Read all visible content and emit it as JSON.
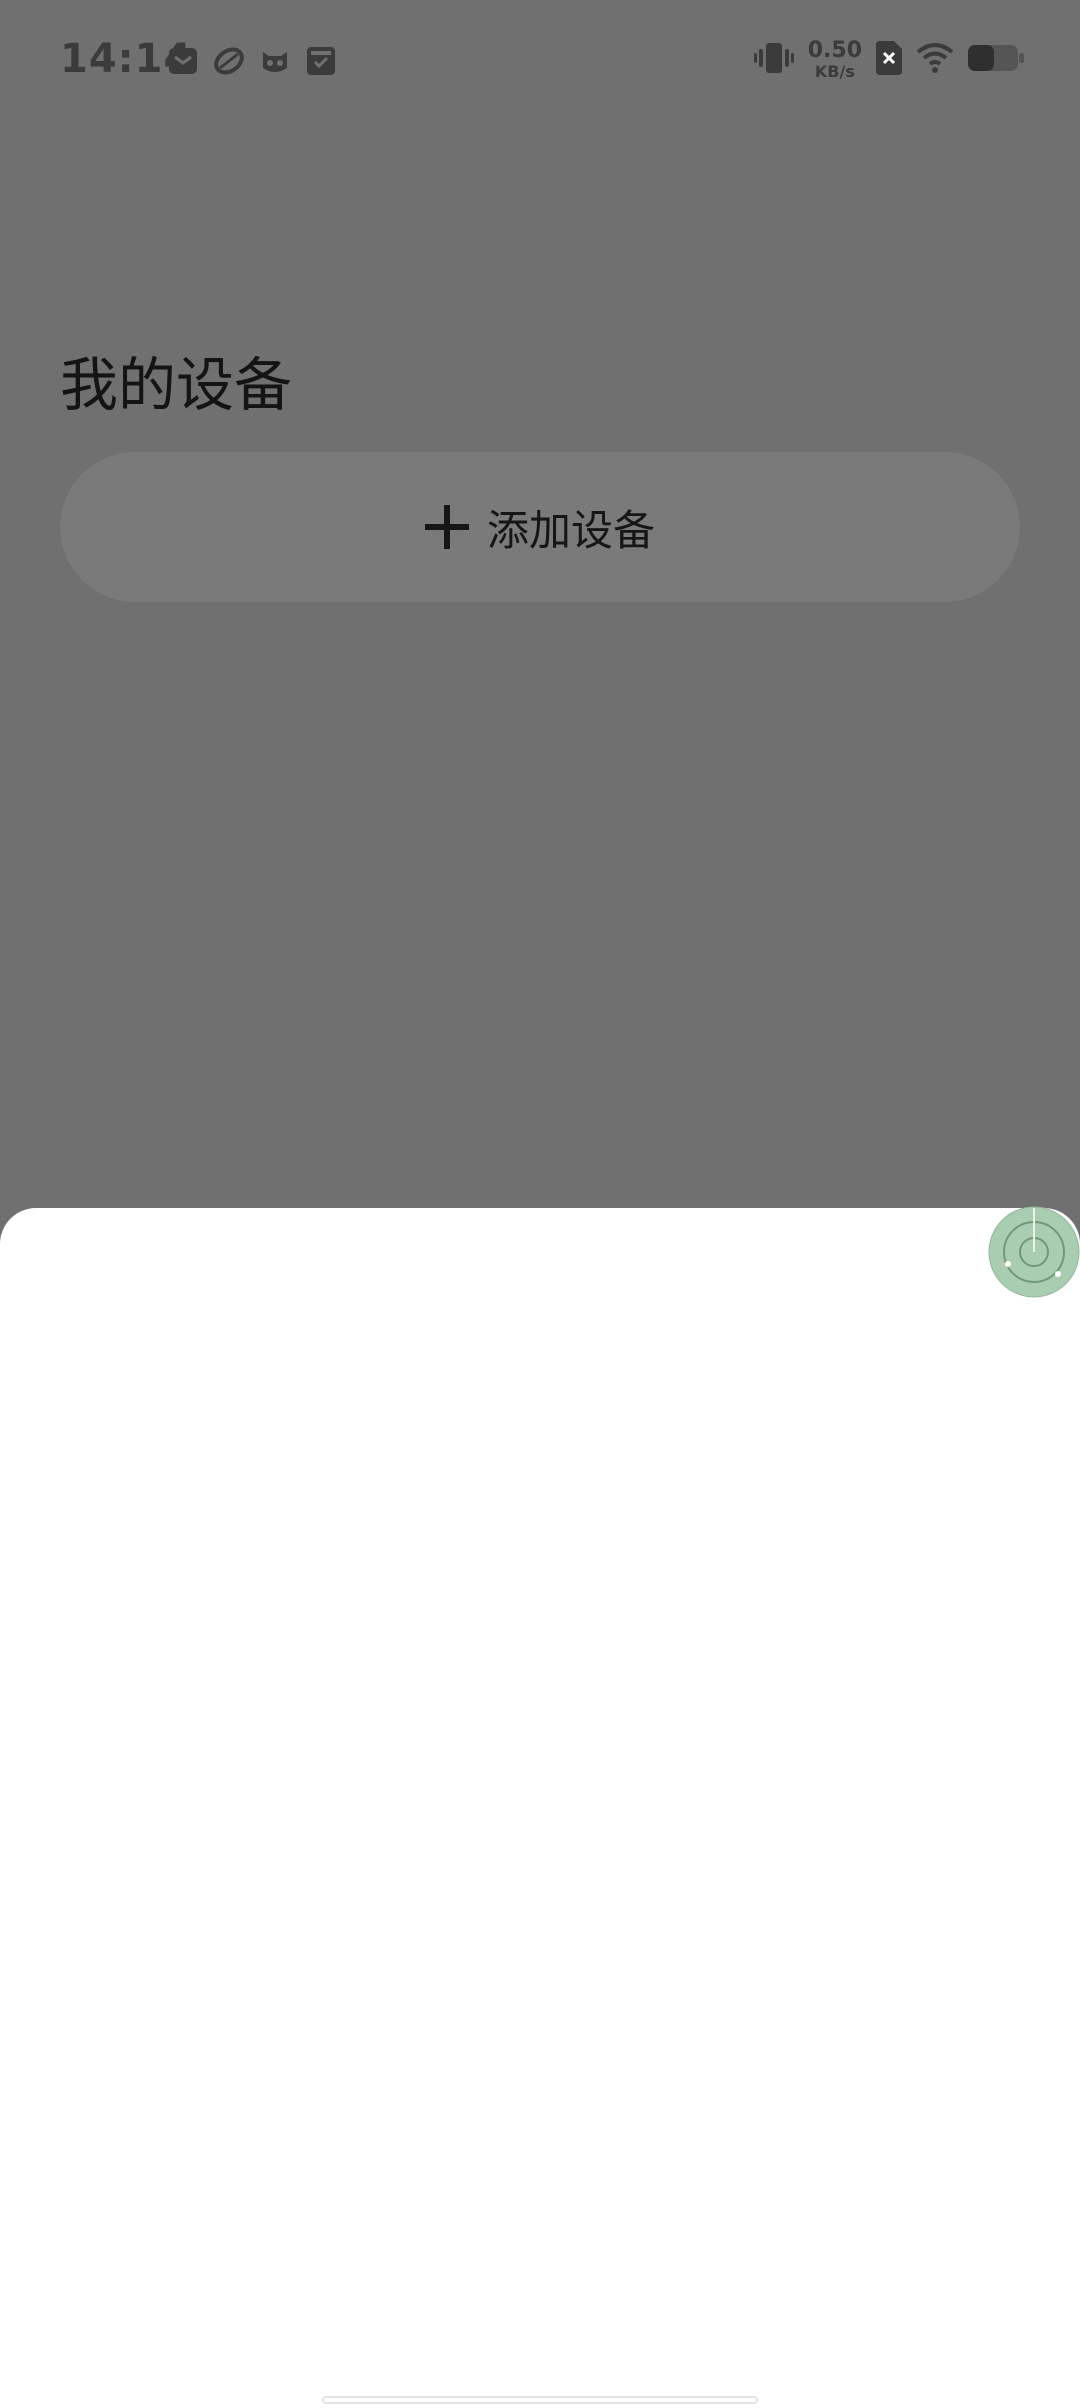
{
  "status_bar": {
    "time": "14:14",
    "network_speed_value": "0.50",
    "network_speed_unit": "KB/s",
    "notification_icons": [
      "mail-icon",
      "leaf-icon",
      "cat-icon",
      "inbox-icon"
    ],
    "right_icons": [
      "vibrate-icon",
      "sim-off-icon",
      "wifi-icon",
      "battery-icon"
    ]
  },
  "page": {
    "title": "我的设备",
    "add_device_label": "添加设备"
  },
  "colors": {
    "overlay_background": "#707070",
    "button_background": "#7a7a7a",
    "sheet_background": "#ffffff",
    "radar_green": "#a9cdb1"
  }
}
